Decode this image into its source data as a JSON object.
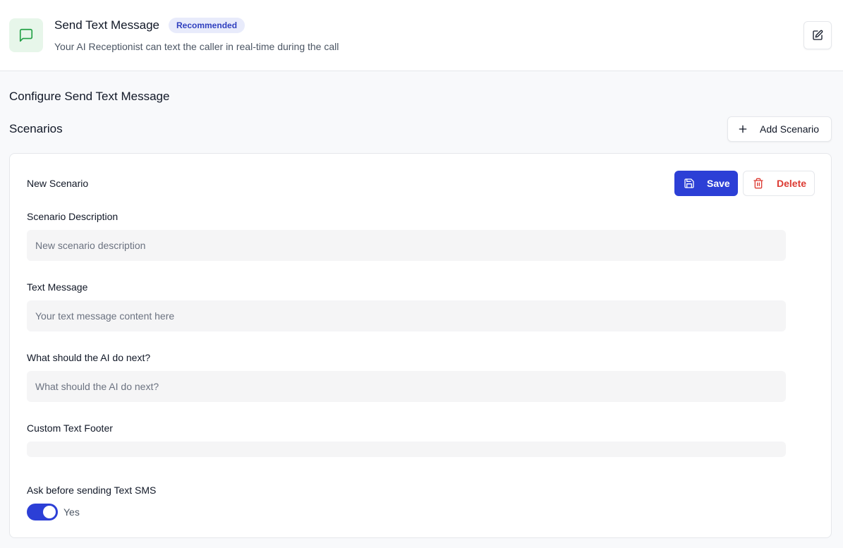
{
  "header": {
    "title": "Send Text Message",
    "badge": "Recommended",
    "subtitle": "Your AI Receptionist can text the caller in real-time during the call",
    "icon": "message-square-icon",
    "edit_icon": "edit-icon"
  },
  "config_title": "Configure Send Text Message",
  "scenarios": {
    "title": "Scenarios",
    "add_label": "Add Scenario"
  },
  "scenario_card": {
    "name": "New Scenario",
    "save_label": "Save",
    "delete_label": "Delete",
    "fields": [
      {
        "label": "Scenario Description",
        "placeholder": "New scenario description",
        "value": ""
      },
      {
        "label": "Text Message",
        "placeholder": "Your text message content here",
        "value": ""
      },
      {
        "label": "What should the AI do next?",
        "placeholder": "What should the AI do next?",
        "value": ""
      },
      {
        "label": "Custom Text Footer",
        "placeholder": "",
        "value": ""
      }
    ],
    "ask_before": {
      "label": "Ask before sending Text SMS",
      "state_label": "Yes",
      "enabled": true
    }
  },
  "colors": {
    "primary": "#2c3fd6",
    "danger": "#dc3b33",
    "icon_green": "#22a045",
    "icon_bg": "#e7f6ea",
    "badge_bg": "#e8ebfb",
    "badge_text": "#2f3fbf"
  }
}
